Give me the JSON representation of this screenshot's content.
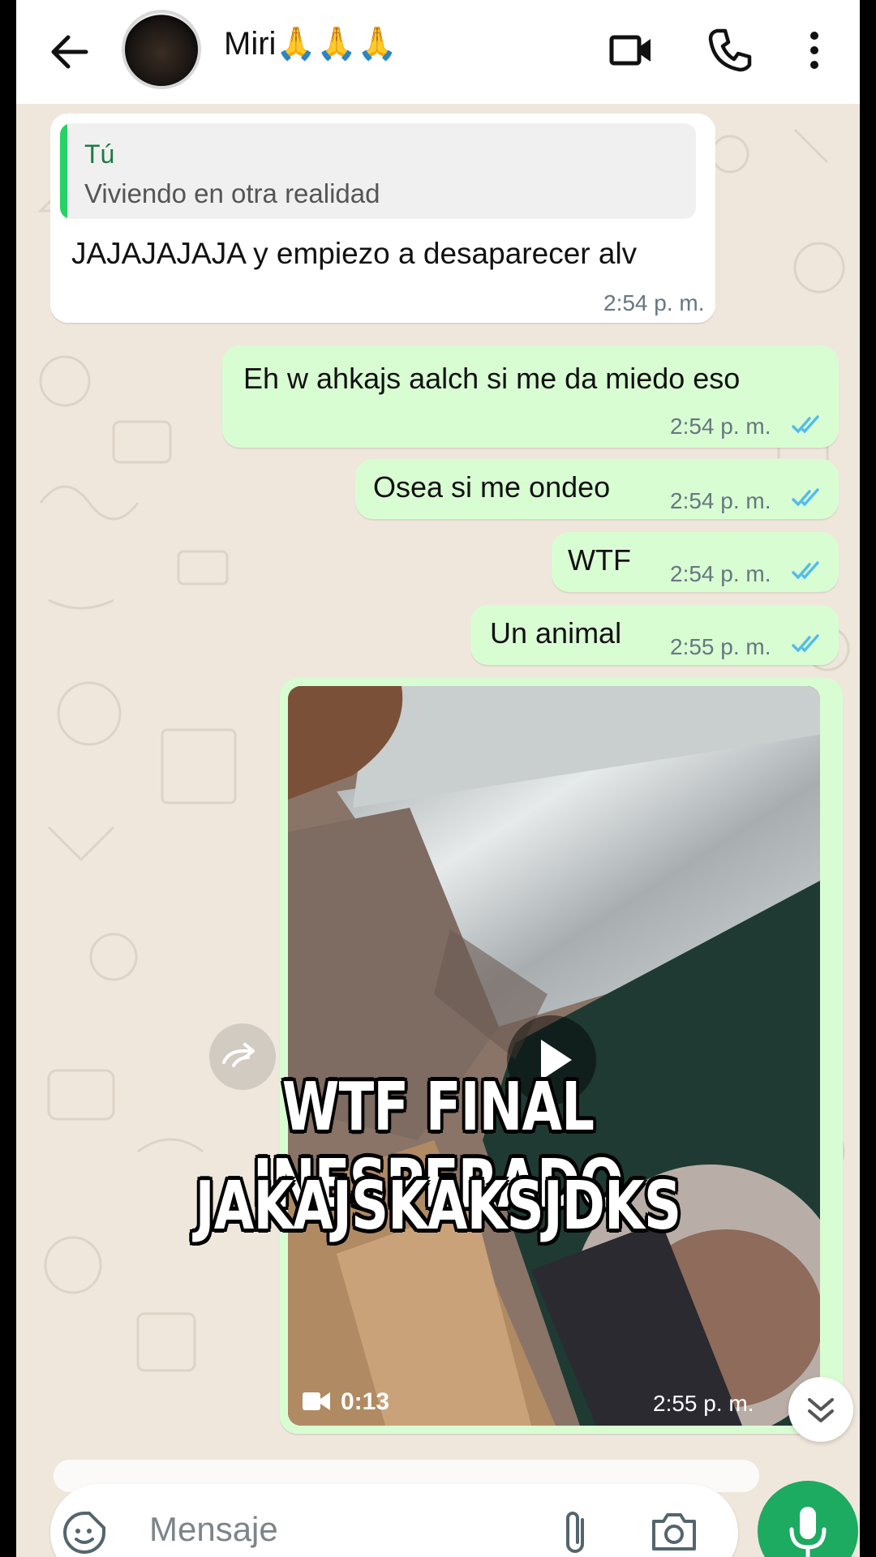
{
  "header": {
    "contact_name": "Miri🙏🙏🙏",
    "back_icon": "arrow-left-icon",
    "video_call_icon": "video-camera-icon",
    "voice_call_icon": "phone-icon",
    "menu_icon": "more-vertical-icon"
  },
  "messages": [
    {
      "direction": "incoming",
      "quote_author": "Tú",
      "quote_text": "Viviendo en otra realidad",
      "text": "JAJAJAJAJA y empiezo a desaparecer alv",
      "time": "2:54 p. m."
    },
    {
      "direction": "outgoing",
      "text": "Eh w ahkajs aalch si me da miedo eso",
      "time": "2:54 p. m.",
      "status": "read"
    },
    {
      "direction": "outgoing",
      "text": "Osea si me ondeo",
      "time": "2:54 p. m.",
      "status": "read"
    },
    {
      "direction": "outgoing",
      "text": "WTF",
      "time": "2:54 p. m.",
      "status": "read"
    },
    {
      "direction": "outgoing",
      "text": "Un animal",
      "time": "2:55 p. m.",
      "status": "read"
    }
  ],
  "video_message": {
    "duration": "0:13",
    "time": "2:55 p. m."
  },
  "overlay": {
    "line1": "WTF FINAL INESPERADO",
    "line2": "JAKAJSKAKSJDKS"
  },
  "composer": {
    "placeholder": "Mensaje",
    "emoji_icon": "sticker-icon",
    "attach_icon": "paperclip-icon",
    "camera_icon": "camera-icon",
    "mic_icon": "microphone-icon"
  },
  "colors": {
    "outgoing_bubble": "#d9fdd3",
    "incoming_bubble": "#ffffff",
    "accent_green": "#1daa61",
    "read_tick": "#53bdeb",
    "chat_background": "#efe7dc"
  }
}
